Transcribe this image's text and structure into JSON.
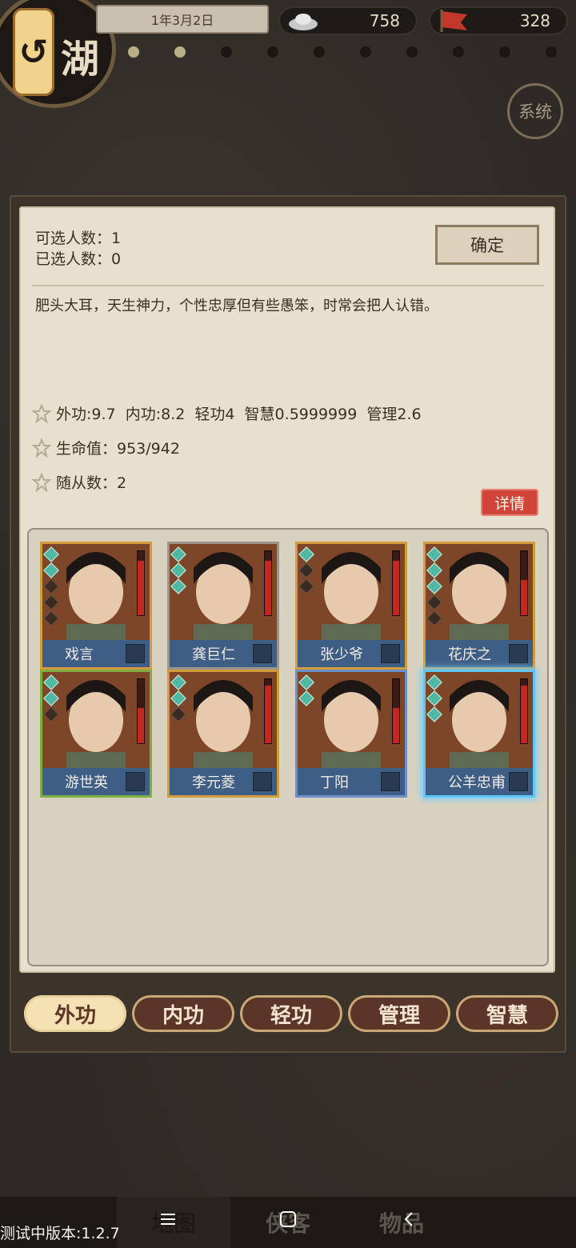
{
  "header": {
    "date": "1年3月2日",
    "silver": "758",
    "banner": "328",
    "logo_char": "湖",
    "system_label": "系统",
    "progress_dots_total": 10,
    "progress_dots_active": 2
  },
  "selection": {
    "selectable": "可选人数：1",
    "selected": "已选人数：0",
    "confirm_label": "确定"
  },
  "character": {
    "description": "肥头大耳，天生神力，个性忠厚但有些愚笨，时常会把人认错。",
    "stats": "外功:9.7  内功:8.2  轻功4  智慧0.5999999  管理2.6",
    "hp": "生命值：953/942",
    "followers": "随从数：2",
    "detail_label": "详情"
  },
  "roster": [
    {
      "name": "戏言",
      "frame": "orange",
      "gems": 5,
      "gems_filled": 2,
      "hp": 0.85
    },
    {
      "name": "龚巨仁",
      "frame": "gray",
      "gems": 3,
      "gems_filled": 3,
      "hp": 0.85
    },
    {
      "name": "张少爷",
      "frame": "orange",
      "gems": 3,
      "gems_filled": 1,
      "hp": 0.85
    },
    {
      "name": "花庆之",
      "frame": "orange",
      "gems": 5,
      "gems_filled": 3,
      "hp": 0.55
    },
    {
      "name": "游世英",
      "frame": "green",
      "gems": 3,
      "gems_filled": 2,
      "hp": 0.55
    },
    {
      "name": "李元菱",
      "frame": "orange",
      "gems": 3,
      "gems_filled": 2,
      "hp": 0.9
    },
    {
      "name": "丁阳",
      "frame": "blue",
      "gems": 2,
      "gems_filled": 2,
      "hp": 0.55
    },
    {
      "name": "公羊忠甫",
      "frame": "glow",
      "gems": 3,
      "gems_filled": 3,
      "hp": 0.9
    }
  ],
  "tabs": [
    "外功",
    "内功",
    "轻功",
    "管理",
    "智慧"
  ],
  "bottom_nav": [
    "地图",
    "侠客",
    "物品"
  ],
  "version": "测试中版本:1.2.7",
  "colors": {
    "accent": "#d0443a",
    "name_bar": "#3f5e86",
    "tab_active": "#f4e2b5",
    "tab": "#5b3525"
  }
}
